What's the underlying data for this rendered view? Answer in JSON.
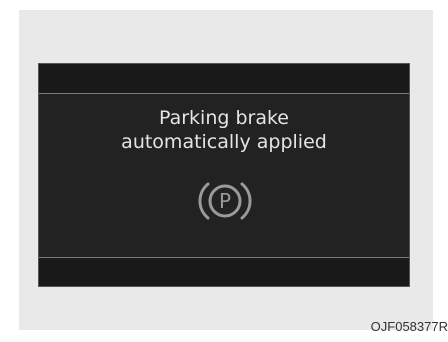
{
  "display": {
    "message_line1": "Parking brake",
    "message_line2": "automatically applied",
    "icon_letter": "P",
    "icon_name": "parking-brake-icon"
  },
  "caption": "OJF058377R",
  "colors": {
    "panel_background": "#e9e9e9",
    "display_background": "#222222",
    "band_background": "#191919",
    "text": "#e4e4e4",
    "icon": "#9a9a9a"
  }
}
